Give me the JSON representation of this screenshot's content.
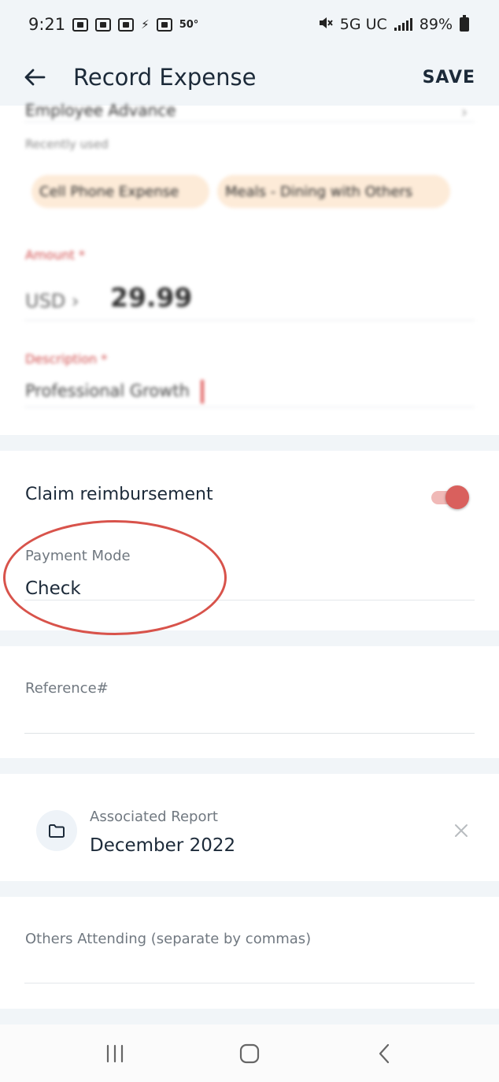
{
  "status_bar": {
    "time": "9:21",
    "temperature": "50°",
    "network": "5G UC",
    "battery_percent": "89%"
  },
  "app_bar": {
    "title": "Record Expense",
    "save_label": "SAVE"
  },
  "expense_form": {
    "category_value": "Employee Advance",
    "recently_used_label": "Recently used",
    "recent_categories": [
      "Cell Phone Expense",
      "Meals - Dining with Others"
    ],
    "amount_label": "Amount *",
    "currency": "USD ›",
    "amount_value": "29.99",
    "description_label": "Description *",
    "description_value": "Professional Growth"
  },
  "reimbursement": {
    "claim_label": "Claim reimbursement",
    "claim_enabled": true,
    "payment_mode_label": "Payment Mode",
    "payment_mode_value": "Check"
  },
  "reference": {
    "label": "Reference#",
    "value": ""
  },
  "associated_report": {
    "label": "Associated Report",
    "value": "December 2022"
  },
  "others_attending": {
    "label": "Others Attending (separate by commas)",
    "value": ""
  },
  "colors": {
    "background": "#f1f5f8",
    "accent_red": "#d9605d",
    "chip_bg": "#fdebd8",
    "highlight_ring": "#d8534b"
  },
  "icons": {
    "back": "arrow-left-icon",
    "folder": "folder-icon",
    "close": "close-icon",
    "nav_recents": "recents-icon",
    "nav_home": "home-icon",
    "nav_back": "chevron-left-icon"
  }
}
